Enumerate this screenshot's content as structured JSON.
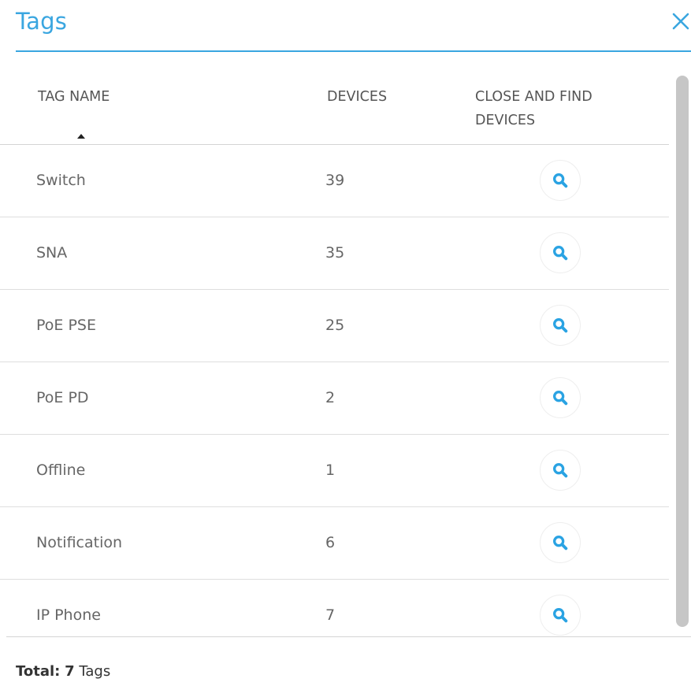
{
  "dialog": {
    "title": "Tags",
    "close_icon": "close-icon",
    "accent_color": "#3aa6e0"
  },
  "table": {
    "columns": {
      "name": "TAG NAME",
      "devices": "DEVICES",
      "find": "CLOSE AND FIND DEVICES"
    },
    "sort": {
      "column": "name",
      "direction": "ascending",
      "icon": "sort-up-icon"
    },
    "rows": [
      {
        "name": "Switch",
        "devices": "39",
        "action_icon": "search-icon"
      },
      {
        "name": "SNA",
        "devices": "35",
        "action_icon": "search-icon"
      },
      {
        "name": "PoE PSE",
        "devices": "25",
        "action_icon": "search-icon"
      },
      {
        "name": "PoE PD",
        "devices": "2",
        "action_icon": "search-icon"
      },
      {
        "name": "Offline",
        "devices": "1",
        "action_icon": "search-icon"
      },
      {
        "name": "Notification",
        "devices": "6",
        "action_icon": "search-icon"
      },
      {
        "name": "IP Phone",
        "devices": "7",
        "action_icon": "search-icon"
      }
    ]
  },
  "footer": {
    "total_prefix": "Total:",
    "total_count": "7",
    "total_suffix": "Tags"
  }
}
